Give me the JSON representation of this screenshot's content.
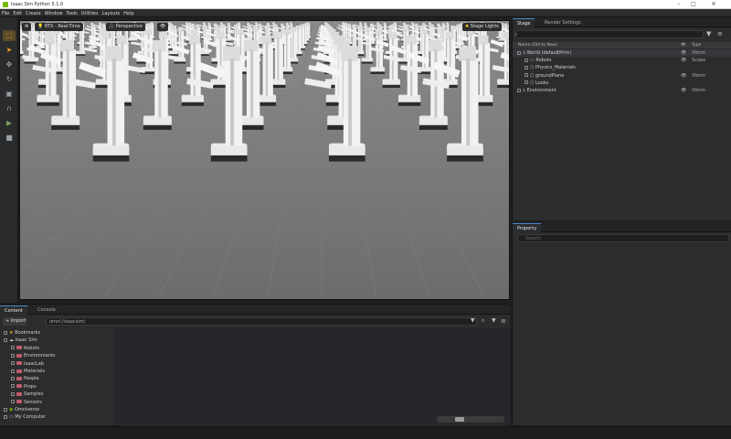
{
  "window": {
    "title": "Isaac Sim Python 5.1.0"
  },
  "menu": [
    "File",
    "Edit",
    "Create",
    "Window",
    "Tools",
    "Utilities",
    "Layouts",
    "Help"
  ],
  "viewport": {
    "renderer_label": "RTX - Real-Time",
    "camera_label": "Perspective",
    "lights_label": "Stage Lights"
  },
  "stage": {
    "tabs": [
      "Stage",
      "Render Settings"
    ],
    "search_placeholder": "",
    "col_name": "Name (Old to New)",
    "col_type": "Type",
    "items": [
      {
        "label": "World (defaultPrim)",
        "type": "Xform"
      },
      {
        "label": "Robots",
        "type": "Scope"
      },
      {
        "label": "Physics_Materials",
        "type": ""
      },
      {
        "label": "groundPlane",
        "type": "Xform"
      },
      {
        "label": "Looks",
        "type": ""
      },
      {
        "label": "Environment",
        "type": "Xform"
      }
    ]
  },
  "property": {
    "tab": "Property",
    "search_placeholder": "Search"
  },
  "content": {
    "tabs": [
      "Content",
      "Console"
    ],
    "import_label": "+ Import",
    "path": "omni:/isaacsim/",
    "tree": [
      {
        "label": "Bookmarks",
        "kind": "bookmark",
        "level": 0
      },
      {
        "label": "Isaac Sim",
        "kind": "cloud",
        "level": 0
      },
      {
        "label": "Robots",
        "kind": "folder",
        "level": 1
      },
      {
        "label": "Environments",
        "kind": "folder",
        "level": 1
      },
      {
        "label": "IsaacLab",
        "kind": "folder",
        "level": 1
      },
      {
        "label": "Materials",
        "kind": "folder",
        "level": 1
      },
      {
        "label": "People",
        "kind": "folder",
        "level": 1
      },
      {
        "label": "Props",
        "kind": "folder",
        "level": 1
      },
      {
        "label": "Samples",
        "kind": "folder",
        "level": 1
      },
      {
        "label": "Sensors",
        "kind": "folder",
        "level": 1
      },
      {
        "label": "Omniverse",
        "kind": "omni",
        "level": 0
      },
      {
        "label": "My Computer",
        "kind": "computer",
        "level": 0
      }
    ]
  },
  "colors": {
    "accent": "#76b900",
    "folder": "#c45b6a",
    "selection": "#4a86c7"
  },
  "tools": [
    "select-icon",
    "move-icon",
    "rotate-icon",
    "scale-icon",
    "snap-icon",
    "play-icon",
    "stop-icon"
  ]
}
